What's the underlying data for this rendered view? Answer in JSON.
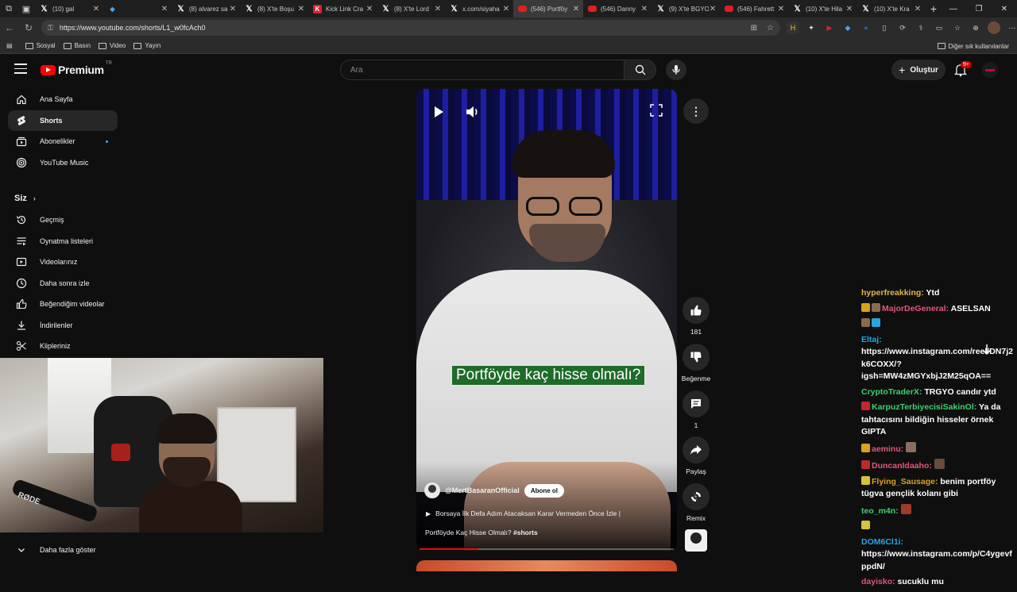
{
  "browser": {
    "tabs": [
      {
        "title": "(10) gal",
        "icon": "x"
      },
      {
        "title": "",
        "icon": "blue"
      },
      {
        "title": "(8) alvarez sa",
        "icon": "x"
      },
      {
        "title": "(8) X'te Boşu",
        "icon": "x"
      },
      {
        "title": "Kick Link Cra",
        "icon": "kick"
      },
      {
        "title": "(8) X'te Lord",
        "icon": "x"
      },
      {
        "title": "x.com/siyaha",
        "icon": "x"
      },
      {
        "title": "(546) Portföy",
        "icon": "yt",
        "active": true
      },
      {
        "title": "(546) Danny",
        "icon": "yt"
      },
      {
        "title": "(9) X'te BGYO",
        "icon": "x"
      },
      {
        "title": "(546) Fahrett",
        "icon": "yt"
      },
      {
        "title": "(10) X'te Hila",
        "icon": "x"
      },
      {
        "title": "(10) X'te Kra",
        "icon": "x"
      }
    ],
    "url": "https://www.youtube.com/shorts/L1_w0fcAch0",
    "bookmarks": [
      "Sosyal",
      "Basın",
      "Video",
      "Yayın"
    ],
    "other_bookmarks": "Diğer sık kullanılanlar"
  },
  "youtube": {
    "logo_text": "Premium",
    "logo_region": "TR",
    "search_placeholder": "Ara",
    "create_label": "Oluştur",
    "notif_count": "9+",
    "sidebar_main": [
      {
        "label": "Ana Sayfa",
        "icon": "home-icon"
      },
      {
        "label": "Shorts",
        "icon": "shorts-icon",
        "active": true
      },
      {
        "label": "Abonelikler",
        "icon": "subscriptions-icon",
        "dot": true
      },
      {
        "label": "YouTube Music",
        "icon": "music-icon"
      }
    ],
    "you_section": "Siz",
    "sidebar_you": [
      {
        "label": "Geçmiş",
        "icon": "history-icon"
      },
      {
        "label": "Oynatma listeleri",
        "icon": "playlist-icon"
      },
      {
        "label": "Videolarınız",
        "icon": "your-videos-icon"
      },
      {
        "label": "Daha sonra izle",
        "icon": "watch-later-icon"
      },
      {
        "label": "Beğendiğim videolar",
        "icon": "liked-icon"
      },
      {
        "label": "İndirilenler",
        "icon": "download-icon"
      },
      {
        "label": "Klipleriniz",
        "icon": "clips-icon"
      }
    ],
    "show_more": "Daha fazla göster",
    "short": {
      "caption": "Portföyde kaç hisse olmalı?",
      "channel": "@MertBasaranOfficial",
      "subscribe_label": "Abone ol",
      "title_line1": "Borsaya İlk Defa Adım Atacaksan Karar Vermeden Önce İzle |",
      "title_line2": "Portföyde Kaç Hisse Olmalı?",
      "hashtag": "#shorts",
      "progress": 0.23,
      "likes": "181",
      "dislike_label": "Beğenme",
      "comments": "1",
      "share_label": "Paylaş",
      "remix_label": "Remix"
    }
  },
  "webcam": {
    "mic_brand": "RØDE",
    "chair_brand": "IG"
  },
  "chat": {
    "messages": [
      {
        "user": "hyperfreakking",
        "color": "#e2b64d",
        "text": "Ytd"
      },
      {
        "user": "MajorDeGeneral",
        "color": "#e0587a",
        "text": "ASELSAN",
        "badges": [
          "#d9a21b",
          "#8c6a4f"
        ]
      },
      {
        "user": "",
        "color": "#ffffff",
        "text": "",
        "badges": [
          "#8c6a4f",
          "#2aa4e0"
        ]
      },
      {
        "user": "Eltaj",
        "color": "#2aa4e0",
        "text": "https://www.instagram.com/reel/DN7j2k6COXX/?igsh=MW4zMGYxbjJ2M25qOA=="
      },
      {
        "user": "CryptoTraderX",
        "color": "#3fcf6f",
        "text": "TRGYO candır ytd"
      },
      {
        "user": "KarpuzTerbiyecisiSakinOl",
        "color": "#3fcf6f",
        "text": "Ya da tahtacısını bildiğin hisseler örnek GIPTA",
        "badges": [
          "#c0282d"
        ]
      },
      {
        "user": "aeminu",
        "color": "#e0587a",
        "text": "",
        "badges": [
          "#d9a21b"
        ],
        "emote": "#8a6f5e"
      },
      {
        "user": "DuncanIdaaho",
        "color": "#e0587a",
        "text": "",
        "badges": [
          "#c0282d"
        ],
        "emote": "#6b4a3a"
      },
      {
        "user": "Flying_Sausage",
        "color": "#d9a21b",
        "text": "benim portföy tügva gençlik kolanı gibi",
        "badges": [
          "#d6c23a"
        ]
      },
      {
        "user": "teo_m4n",
        "color": "#3fcf6f",
        "text": "",
        "emote": "#a03a2a"
      },
      {
        "user": "",
        "color": "#ffffff",
        "text": "",
        "badges": [
          "#d6c23a"
        ]
      },
      {
        "user": "DOM6Cl1i",
        "color": "#2aa4e0",
        "text": "https://www.instagram.com/p/C4ygevfppdN/"
      },
      {
        "user": "dayisko",
        "color": "#e0587a",
        "text": "sucuklu mu"
      }
    ]
  }
}
